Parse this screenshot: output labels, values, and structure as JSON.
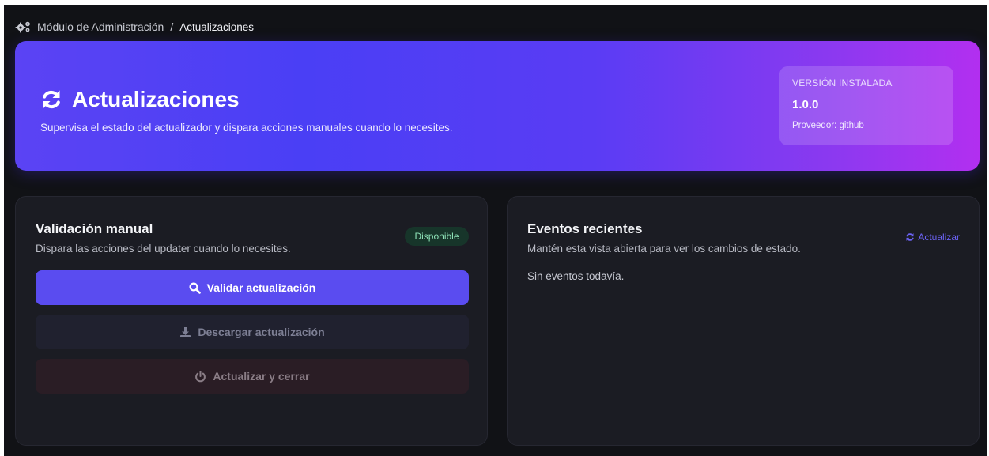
{
  "breadcrumb": {
    "icon": "cogs-icon",
    "root": "Módulo de Administración",
    "separator": "/",
    "current": "Actualizaciones"
  },
  "hero": {
    "icon": "refresh-icon",
    "title": "Actualizaciones",
    "subtitle": "Supervisa el estado del actualizador y dispara acciones manuales cuando lo necesites.",
    "version_card": {
      "label": "VERSIÓN INSTALADA",
      "version": "1.0.0",
      "provider": "Proveedor: github"
    },
    "gradient": [
      "#5b43f4",
      "#b22ff0"
    ]
  },
  "manual": {
    "title": "Validación manual",
    "description": "Dispara las acciones del updater cuando lo necesites.",
    "badge": "Disponible",
    "buttons": {
      "validate": {
        "label": "Validar actualización",
        "icon": "search-icon"
      },
      "download": {
        "label": "Descargar actualización",
        "icon": "download-icon"
      },
      "update_close": {
        "label": "Actualizar y cerrar",
        "icon": "power-icon"
      }
    }
  },
  "events": {
    "title": "Eventos recientes",
    "description": "Mantén esta vista abierta para ver los cambios de estado.",
    "refresh_label": "Actualizar",
    "refresh_icon": "refresh-icon",
    "empty": "Sin eventos todavía."
  },
  "colors": {
    "background": "#111216",
    "card": "#1b1c23",
    "accent": "#5a4cf0",
    "success_badge": "#8de0b6"
  }
}
